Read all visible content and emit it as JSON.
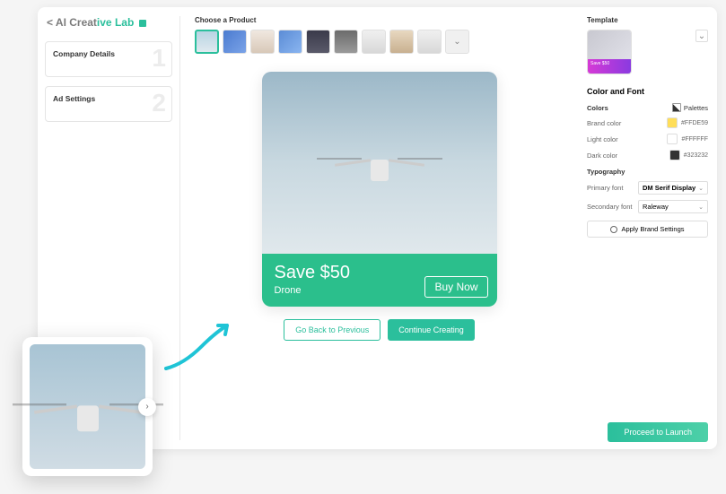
{
  "brand": {
    "back": "<",
    "light": " AI Creat",
    "bold": "ive Lab"
  },
  "sidebar": {
    "steps": [
      {
        "title": "Company Details",
        "num": "1"
      },
      {
        "title": "Ad Settings",
        "num": "2"
      }
    ]
  },
  "center": {
    "choose_label": "Choose a Product",
    "more_icon": "⌄"
  },
  "ad": {
    "save_text": "Save $50",
    "product": "Drone",
    "buy_label": "Buy Now"
  },
  "actions": {
    "back": "Go Back to Previous",
    "continue": "Continue Creating"
  },
  "right": {
    "template_label": "Template",
    "tmpl_save": "Save $50",
    "color_font": "Color and Font",
    "colors_label": "Colors",
    "palettes_label": "Palettes",
    "brand_color_label": "Brand color",
    "brand_color": "#FFDE59",
    "light_color_label": "Light color",
    "light_color": "#FFFFFF",
    "dark_color_label": "Dark color",
    "dark_color": "#323232",
    "typography_label": "Typography",
    "primary_font_label": "Primary font",
    "primary_font": "DM Serif Display",
    "secondary_font_label": "Secondary font",
    "secondary_font": "Raleway",
    "apply_label": "Apply Brand Settings"
  },
  "launch_label": "Proceed to Launch",
  "icons": {
    "chev_down": "⌄",
    "chev_right": "›"
  }
}
